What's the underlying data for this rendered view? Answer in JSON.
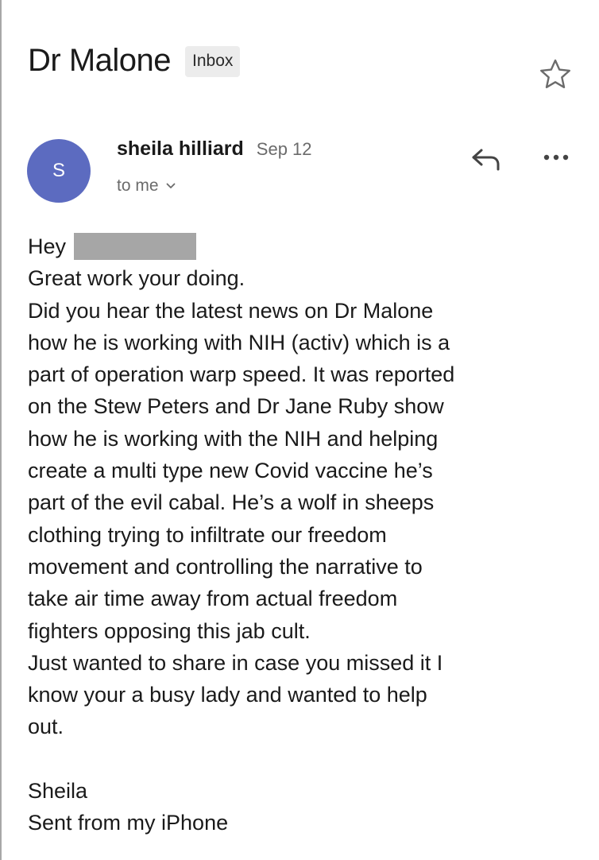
{
  "email": {
    "subject": "Dr Malone",
    "label": "Inbox",
    "sender": {
      "initial": "S",
      "name": "sheila hilliard",
      "date": "Sep 12",
      "recipient": "to me",
      "avatar_color": "#5c6bc0"
    },
    "icons": {
      "star": "star-icon",
      "reply": "reply-icon",
      "more": "more-options-icon",
      "chevron": "chevron-down-icon"
    },
    "body": {
      "greeting": "Hey",
      "lines": [
        "Great work your doing.",
        "Did you hear the latest news on Dr Malone",
        "how he is working with NIH (activ) which is a",
        "part of operation warp speed. It was reported",
        "on the Stew Peters and Dr Jane Ruby show",
        "how he is working with the NIH and helping",
        "create a multi type new Covid vaccine he’s",
        "part of the evil cabal. He’s a wolf in sheeps",
        "clothing trying to infiltrate our freedom",
        "movement and controlling the narrative to",
        "take air time away from actual freedom",
        "fighters opposing this jab cult.",
        "Just wanted to share in case you missed it I",
        "know your a busy lady and wanted to help",
        "out."
      ],
      "signature": "Sheila",
      "footer": "Sent from my iPhone"
    }
  }
}
